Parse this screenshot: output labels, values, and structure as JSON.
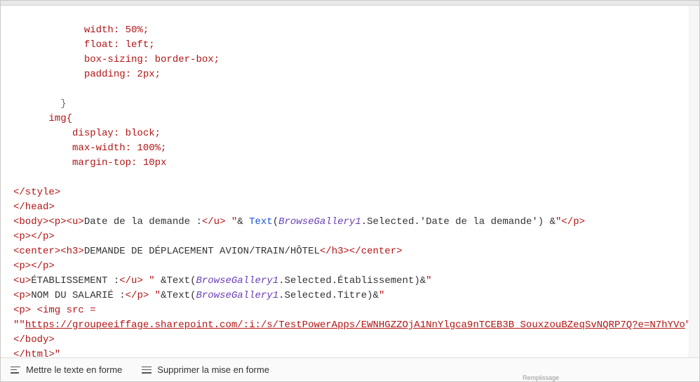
{
  "code": {
    "l1": "            width: 50%;",
    "l2": "            float: left;",
    "l3": "            box-sizing: border-box;",
    "l4": "            padding: 2px;",
    "l5": " ",
    "l6": "        }",
    "l7": "      img{",
    "l8": "          display: block;",
    "l9": "          max-width: 100%;",
    "l10": "          margin-top: 10px",
    "l11": " ",
    "l12": "</style>",
    "l13": "</head>",
    "l14a": "<body><p><u>",
    "l14b": "Date de la demande :",
    "l14c": "</u> \"",
    "l14d": "& ",
    "l14e": "Text",
    "l14f": "(",
    "l14g": "BrowseGallery1",
    "l14h": ".Selected.'Date de la demande') &",
    "l14i": "\"</p>",
    "l15": "<p></p>",
    "l16": "<center><h3>",
    "l16b": "DEMANDE DE DÉPLACEMENT AVION/TRAIN/HÔTEL",
    "l16c": "</h3></center>",
    "l17": "<p></p>",
    "l18a": "<u>",
    "l18b": "ÉTABLISSEMENT :",
    "l18c": "</u> \" ",
    "l18d": "&Text(",
    "l18e": "BrowseGallery1",
    "l18f": ".Selected.Établissement)&",
    "l18g": "\"",
    "l19a": "<p>",
    "l19b": "NOM DU SALARIÉ :",
    "l19c": "</p> \"",
    "l19d": "&Text(",
    "l19e": "BrowseGallery1",
    "l19f": ".Selected.Titre)&",
    "l19g": "\"",
    "l20a": "<p> <img src = ",
    "l21a": "\"\"",
    "l21b": "https://groupeeiffage.sharepoint.com/:i:/s/TestPowerApps/EWNHGZZOjA1NnYlgca9nTCEB3B_SouxzouBZeqSvNQRP7Q?e=N7hYVo",
    "l21c": "\"\"></p>",
    "l22": "</body>",
    "l23": "</html>\""
  },
  "toolbar": {
    "format_label": "Mettre le texte en forme",
    "remove_label": "Supprimer la mise en forme"
  },
  "footerHint": "Remplissage"
}
